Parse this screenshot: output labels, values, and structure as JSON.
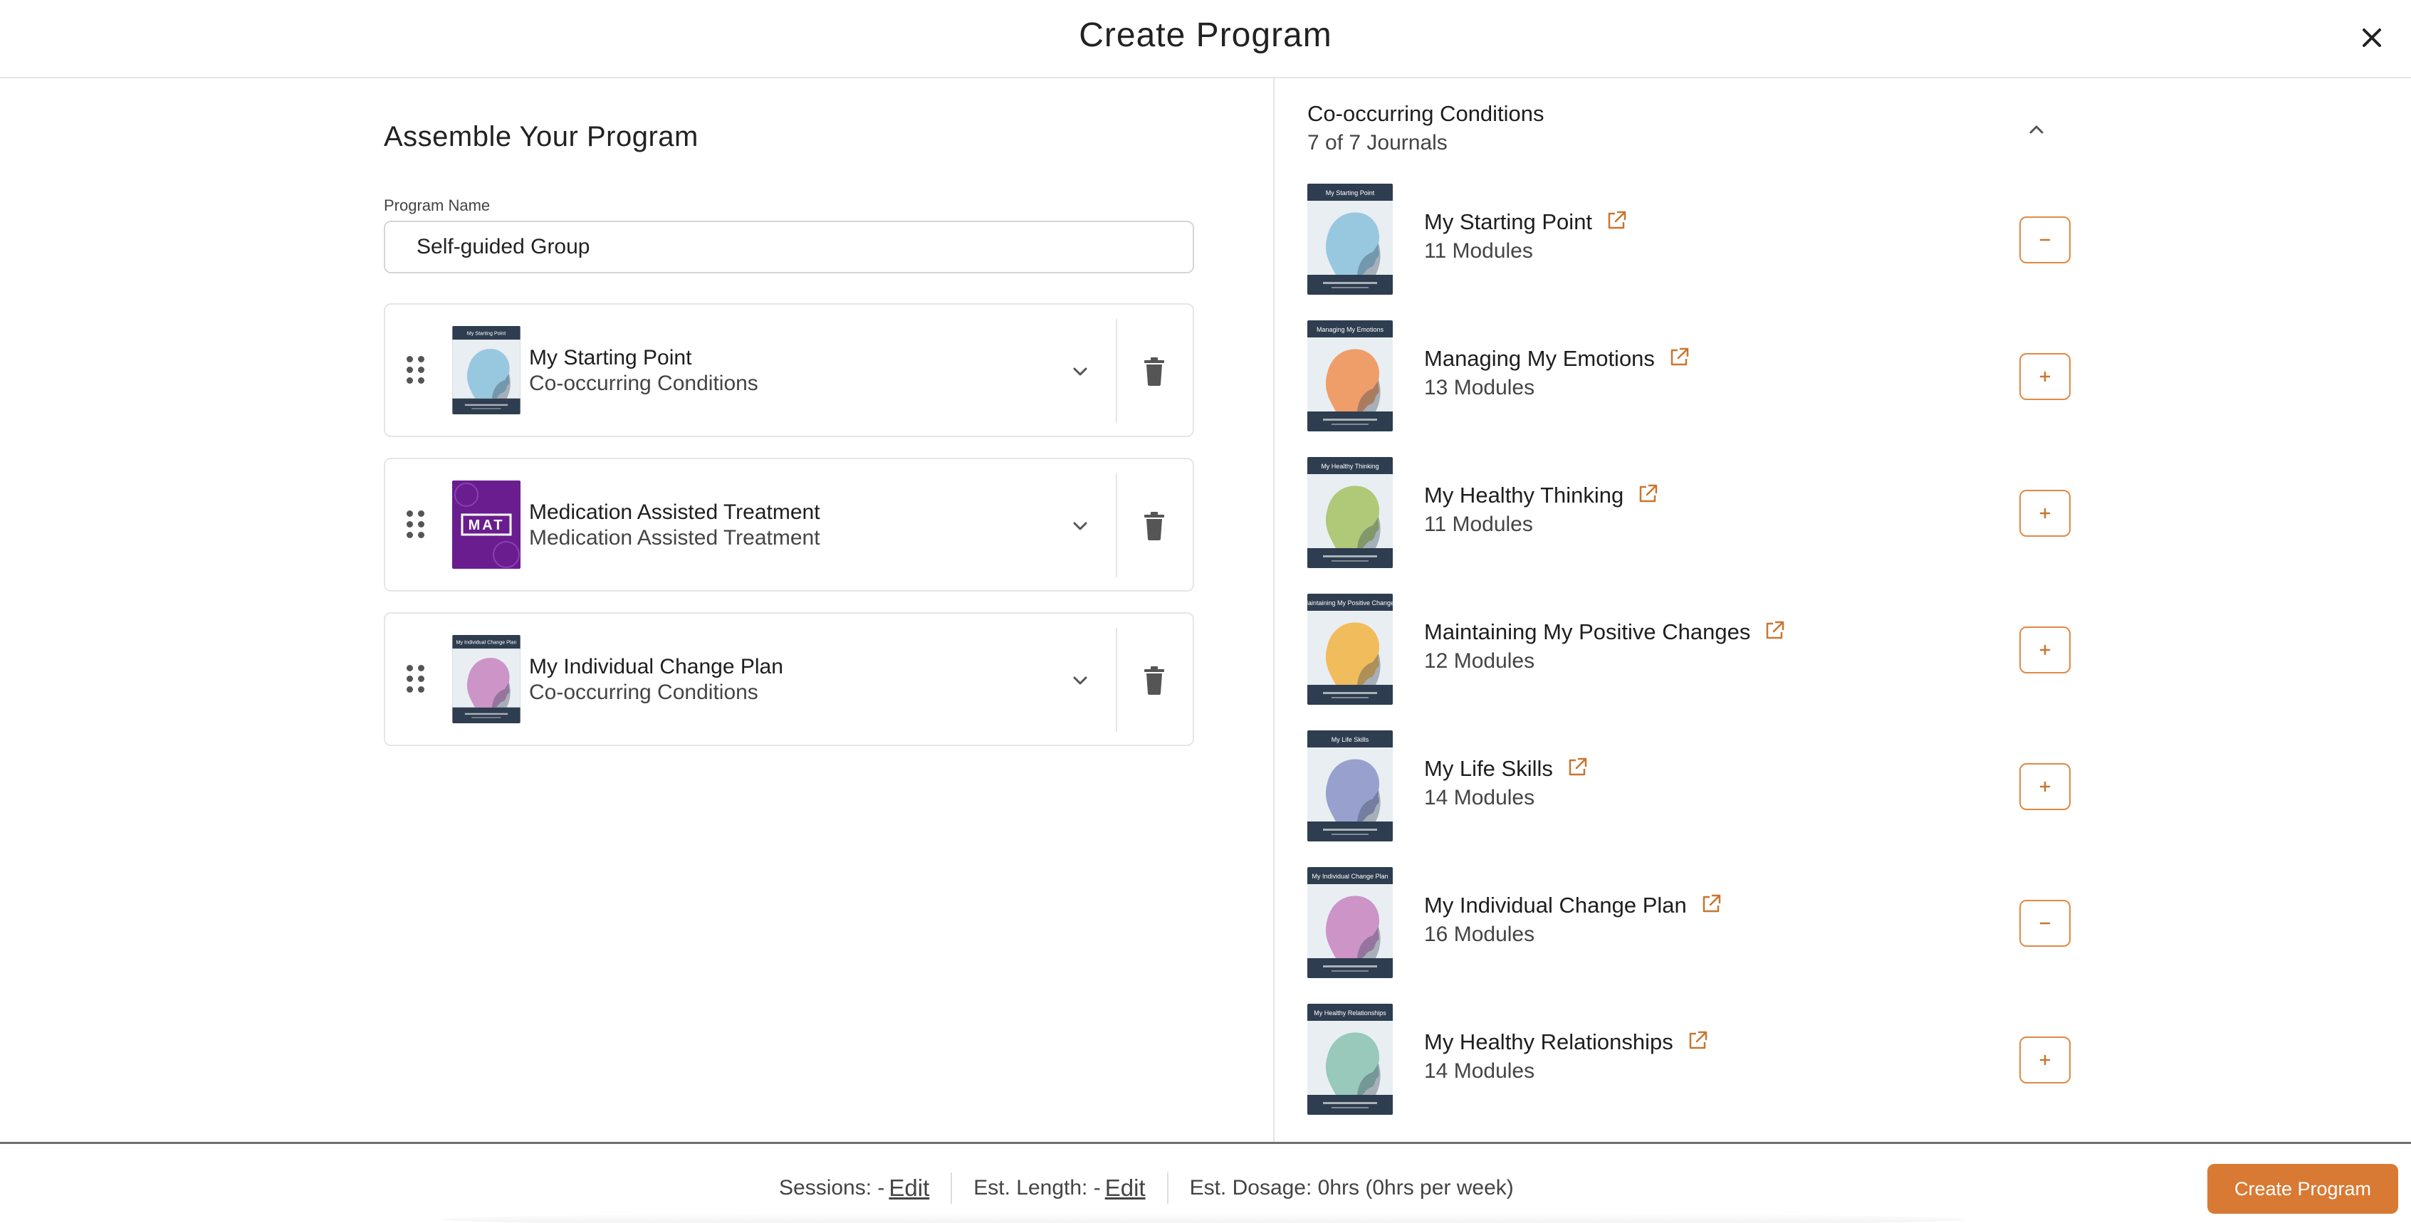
{
  "header": {
    "title": "Create Program"
  },
  "assemble": {
    "title": "Assemble Your Program",
    "name_label": "Program Name",
    "name_value": "Self-guided Group",
    "items": [
      {
        "title": "My Starting Point",
        "subtitle": "Co-occurring Conditions",
        "cover": {
          "text": "My Starting Point",
          "bg": "#2e3d4f",
          "accent": "#8fc3dd"
        }
      },
      {
        "title": "Medication Assisted Treatment",
        "subtitle": "Medication Assisted Treatment",
        "cover": {
          "text": "MAT",
          "bg": "#6a1d8f",
          "accent": "#ffffff"
        }
      },
      {
        "title": "My Individual Change Plan",
        "subtitle": "Co-occurring Conditions",
        "cover": {
          "text": "My Individual Change Plan",
          "bg": "#2e3d4f",
          "accent": "#c98ac2"
        }
      }
    ]
  },
  "library": {
    "group_title": "Co-occurring Conditions",
    "group_count": "7 of 7 Journals",
    "journals": [
      {
        "title": "My Starting Point",
        "modules": "11 Modules",
        "action": "remove",
        "cover": {
          "text": "My Starting Point",
          "accent": "#8fc3dd"
        }
      },
      {
        "title": "Managing My Emotions",
        "modules": "13 Modules",
        "action": "add",
        "cover": {
          "text": "Managing My Emotions",
          "accent": "#f0945a"
        }
      },
      {
        "title": "My Healthy Thinking",
        "modules": "11 Modules",
        "action": "add",
        "cover": {
          "text": "My Healthy Thinking",
          "accent": "#a8c46a"
        }
      },
      {
        "title": "Maintaining My Positive Changes",
        "modules": "12 Modules",
        "action": "add",
        "cover": {
          "text": "Maintaining My Positive Changes",
          "accent": "#f2b64a"
        }
      },
      {
        "title": "My Life Skills",
        "modules": "14 Modules",
        "action": "add",
        "cover": {
          "text": "My Life Skills",
          "accent": "#8f98c9"
        }
      },
      {
        "title": "My Individual Change Plan",
        "modules": "16 Modules",
        "action": "remove",
        "cover": {
          "text": "My Individual Change Plan",
          "accent": "#c98ac2"
        }
      },
      {
        "title": "My Healthy Relationships",
        "modules": "14 Modules",
        "action": "add",
        "cover": {
          "text": "My Healthy Relationships",
          "accent": "#8fc4b5"
        }
      }
    ]
  },
  "footer": {
    "sessions_label": "Sessions: -",
    "sessions_edit": "Edit",
    "length_label": "Est. Length: -",
    "length_edit": "Edit",
    "dosage": "Est. Dosage: 0hrs (0hrs per week)",
    "create_label": "Create Program"
  },
  "colors": {
    "accent": "#d87a33",
    "cover_dark": "#2e3d4f",
    "border": "#e6e6e6"
  }
}
